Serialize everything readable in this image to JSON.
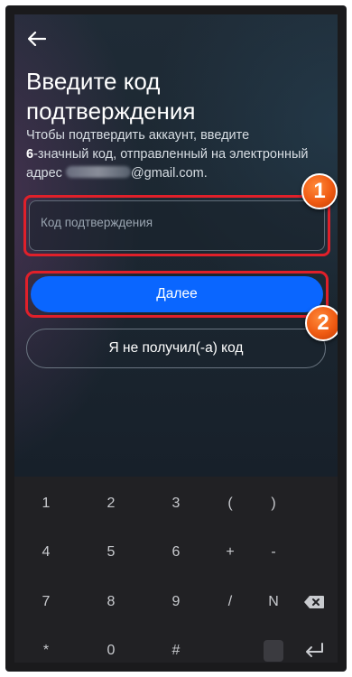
{
  "header": {
    "back_icon": "arrow-left-icon"
  },
  "title": "Введите код подтверждения",
  "description": {
    "part1": "Чтобы подтвердить аккаунт, введите",
    "bold": "6",
    "part2": "-значный код, отправленный на электронный адрес",
    "email_suffix": "@gmail.com."
  },
  "code_input": {
    "placeholder": "Код подтверждения",
    "value": ""
  },
  "buttons": {
    "next_label": "Далее",
    "resend_label": "Я не получил(-а) код"
  },
  "annotations": {
    "badge1": "1",
    "badge2": "2",
    "highlight_color": "#e0202a",
    "badge_color": "#ef5a12"
  },
  "colors": {
    "primary_button": "#0a66ff",
    "keyboard_bg": "#212124"
  },
  "keyboard": {
    "row1": [
      "1",
      "2",
      "3",
      "(",
      ")",
      ""
    ],
    "row2": [
      "4",
      "5",
      "6",
      "+",
      "-",
      ""
    ],
    "row3": [
      "7",
      "8",
      "9",
      "/",
      "N",
      "backspace-icon"
    ],
    "row4": [
      "*",
      "0",
      "#",
      "",
      "blank-key",
      "enter-icon"
    ]
  },
  "keys": {
    "k1": "1",
    "k2": "2",
    "k3": "3",
    "kparl": "(",
    "kparr": ")",
    "k4": "4",
    "k5": "5",
    "k6": "6",
    "kplus": "+",
    "kminus": "-",
    "k7": "7",
    "k8": "8",
    "k9": "9",
    "kslash": "/",
    "kN": "N",
    "kstar": "*",
    "k0": "0",
    "khash": "#"
  }
}
